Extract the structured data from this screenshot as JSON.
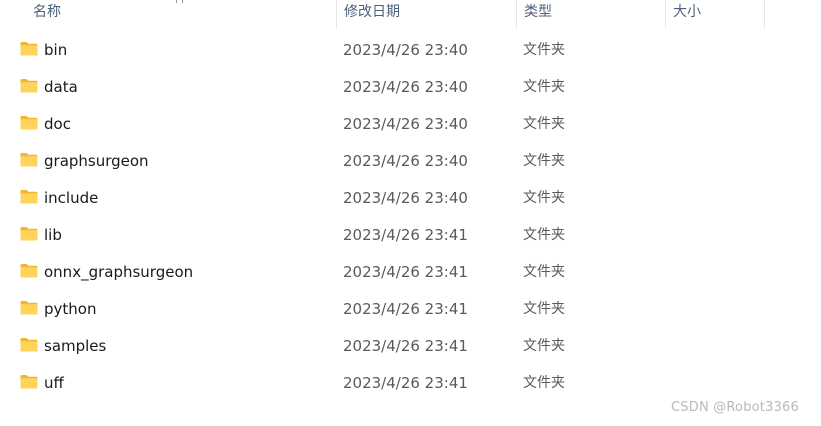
{
  "columns": {
    "name": "名称",
    "date": "修改日期",
    "type": "类型",
    "size": "大小"
  },
  "rows": [
    {
      "name": "bin",
      "date": "2023/4/26 23:40",
      "type": "文件夹",
      "icon": "folder-icon"
    },
    {
      "name": "data",
      "date": "2023/4/26 23:40",
      "type": "文件夹",
      "icon": "folder-icon"
    },
    {
      "name": "doc",
      "date": "2023/4/26 23:40",
      "type": "文件夹",
      "icon": "folder-icon"
    },
    {
      "name": "graphsurgeon",
      "date": "2023/4/26 23:40",
      "type": "文件夹",
      "icon": "folder-icon"
    },
    {
      "name": "include",
      "date": "2023/4/26 23:40",
      "type": "文件夹",
      "icon": "folder-icon"
    },
    {
      "name": "lib",
      "date": "2023/4/26 23:41",
      "type": "文件夹",
      "icon": "folder-icon"
    },
    {
      "name": "onnx_graphsurgeon",
      "date": "2023/4/26 23:41",
      "type": "文件夹",
      "icon": "folder-icon"
    },
    {
      "name": "python",
      "date": "2023/4/26 23:41",
      "type": "文件夹",
      "icon": "folder-icon"
    },
    {
      "name": "samples",
      "date": "2023/4/26 23:41",
      "type": "文件夹",
      "icon": "folder-icon"
    },
    {
      "name": "uff",
      "date": "2023/4/26 23:41",
      "type": "文件夹",
      "icon": "folder-icon"
    }
  ],
  "watermark": "CSDN @Robot3366",
  "colors": {
    "folder_body": "#ffd35c",
    "folder_back": "#f2b62e",
    "header_text": "#4c607a"
  }
}
